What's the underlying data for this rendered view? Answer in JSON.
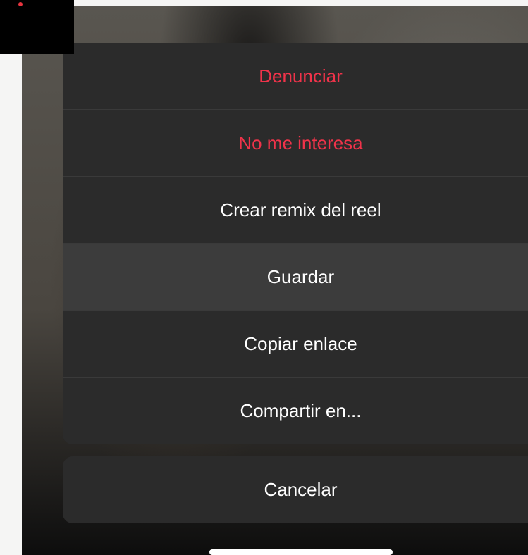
{
  "action_sheet": {
    "items": [
      {
        "label": "Denunciar",
        "style": "destructive"
      },
      {
        "label": "No me interesa",
        "style": "destructive"
      },
      {
        "label": "Crear remix del reel",
        "style": "default"
      },
      {
        "label": "Guardar",
        "style": "default"
      },
      {
        "label": "Copiar enlace",
        "style": "default"
      },
      {
        "label": "Compartir en...",
        "style": "default"
      }
    ],
    "highlighted_index": 3
  },
  "cancel": {
    "label": "Cancelar"
  },
  "colors": {
    "destructive": "#f0334a",
    "sheet_background": "#2b2b2b",
    "highlight_background": "#3c3c3c",
    "default_text": "#ffffff",
    "recording_dot": "#e8343f"
  }
}
